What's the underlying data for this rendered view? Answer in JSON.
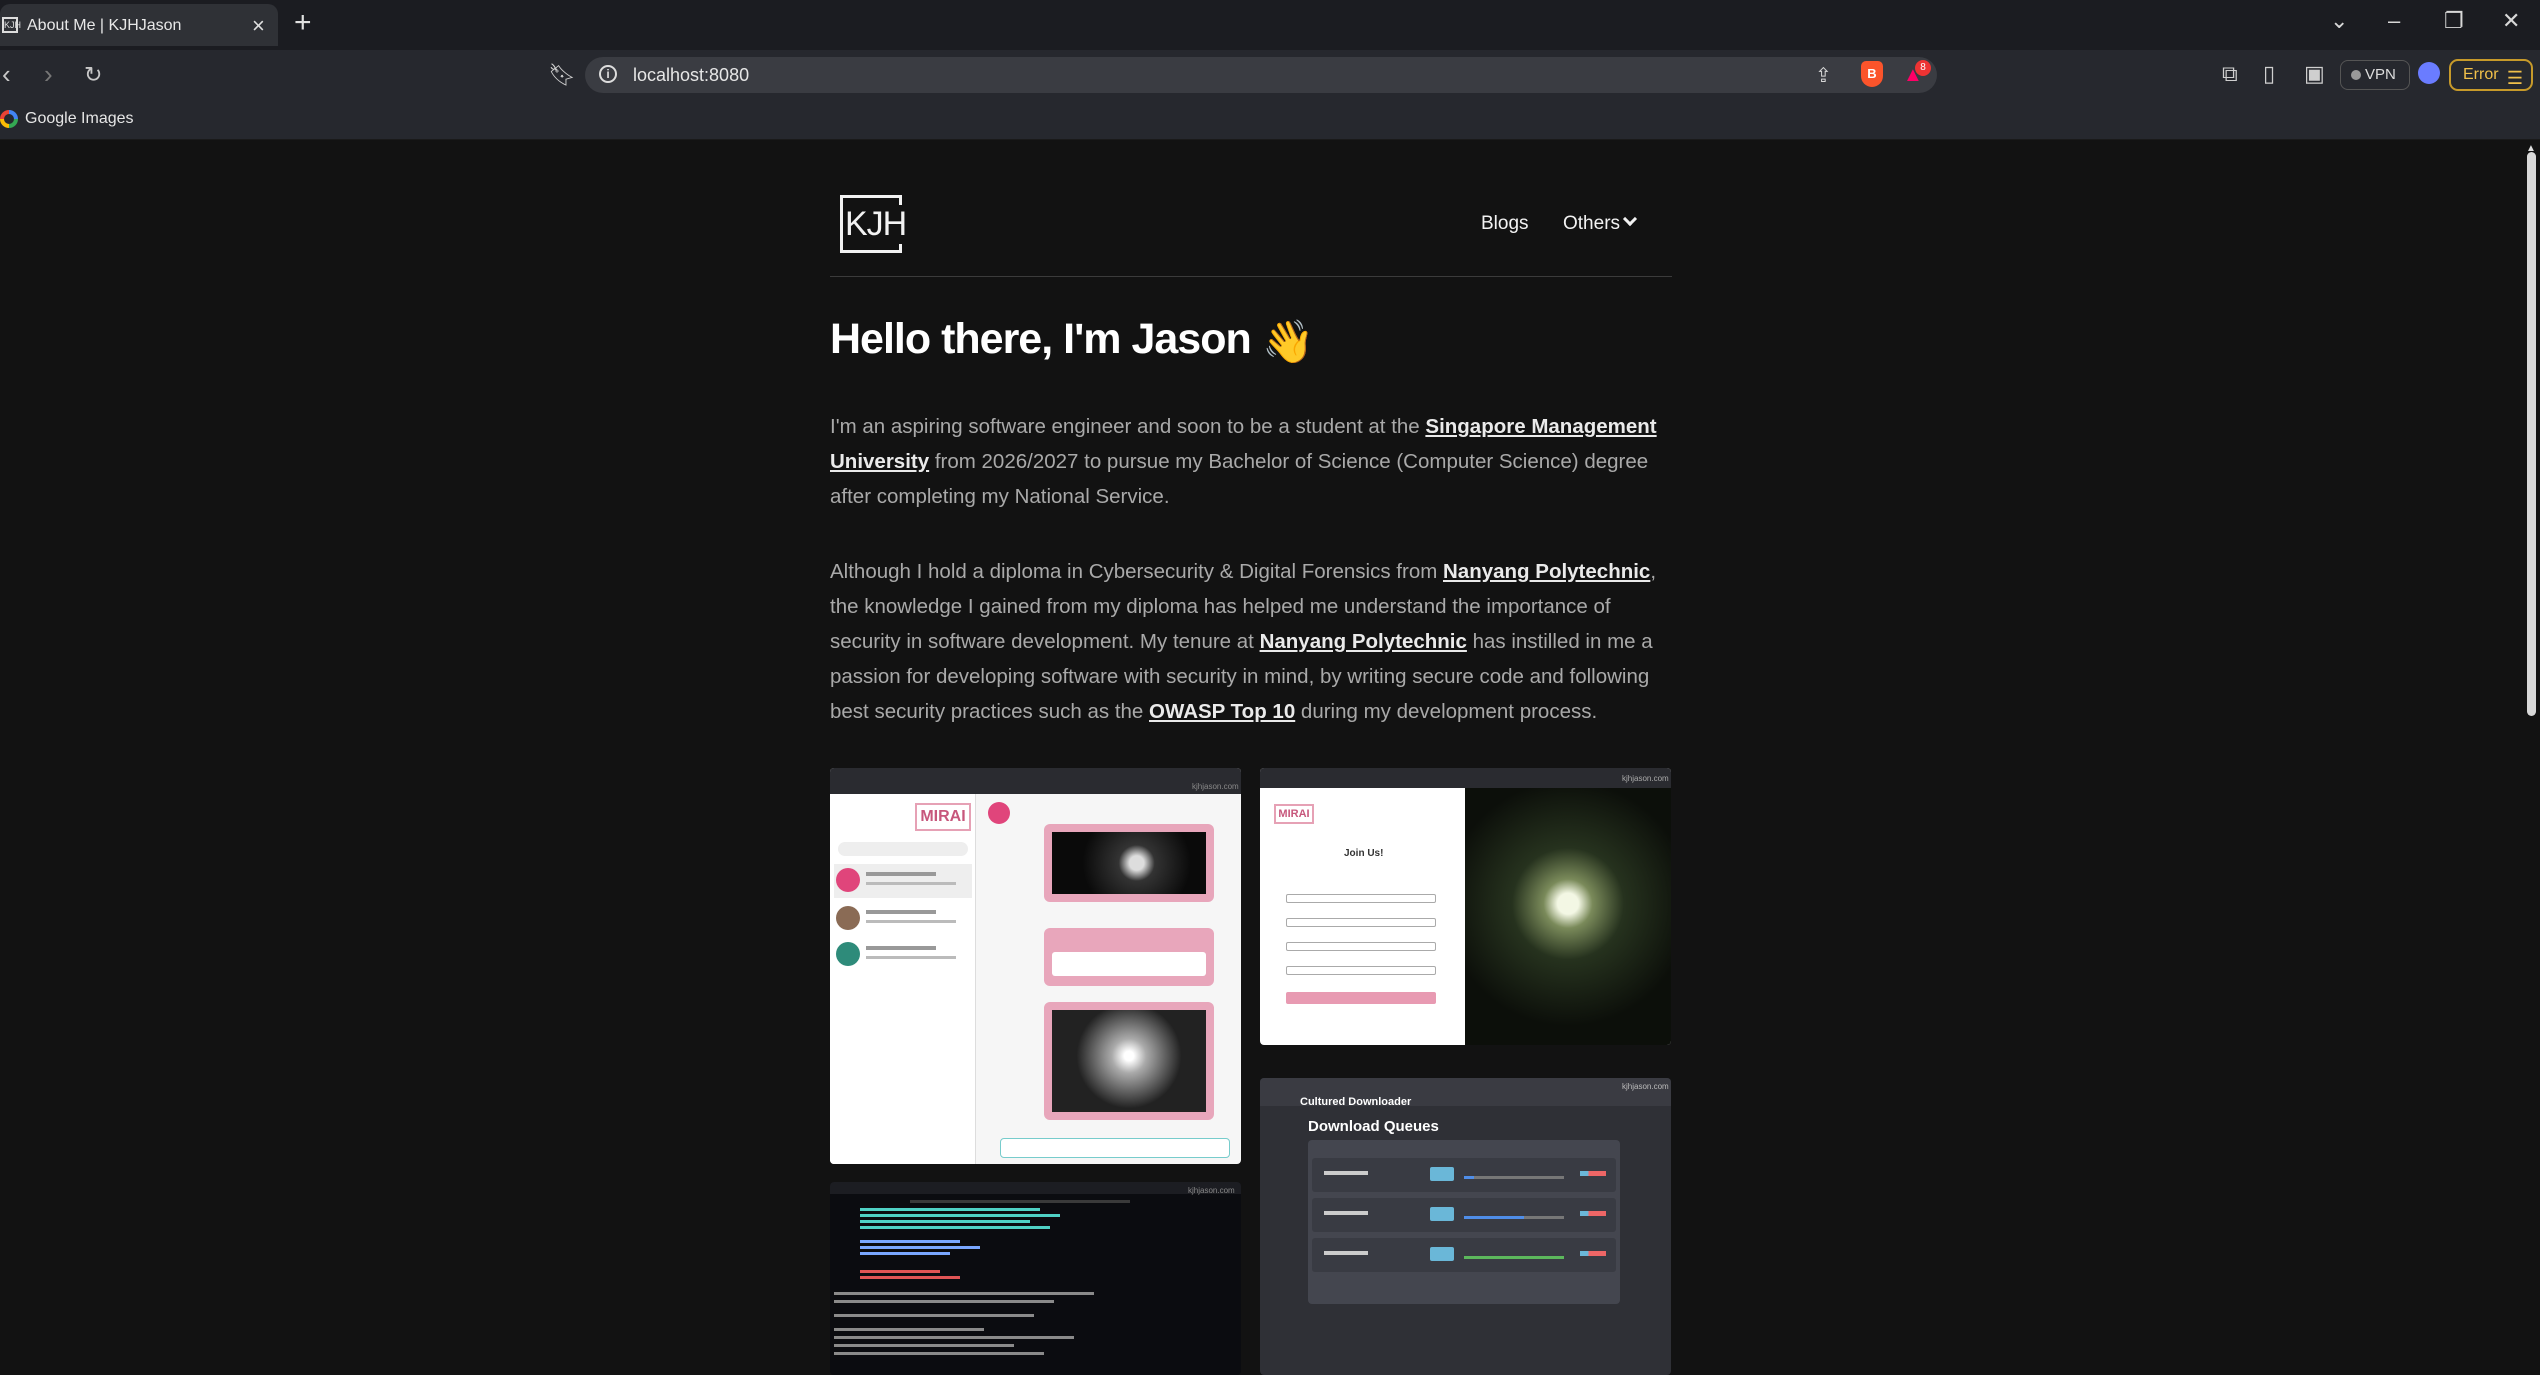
{
  "browser": {
    "tab_title": "About Me | KJHJason",
    "tab_favicon": "KJH",
    "url": "localhost:8080",
    "bookmark": "Google Images",
    "vpn_label": "VPN",
    "error_label": "Error",
    "rewards_badge": "8"
  },
  "site": {
    "logo": "KJH",
    "nav": [
      {
        "label": "Blogs"
      },
      {
        "label": "Others"
      }
    ]
  },
  "hero": {
    "title": "Hello there, I'm Jason",
    "emoji": "👋"
  },
  "intro": {
    "p1_a": "I'm an aspiring software engineer and soon to be a student at the ",
    "p1_link": "Singapore Management University",
    "p1_b": " from 2026/2027 to pursue my Bachelor of Science (Computer Science) degree after completing my National Service.",
    "p2_a": "Although I hold a diploma in Cybersecurity & Digital Forensics from ",
    "p2_link1": "Nanyang Polytechnic",
    "p2_b": ", the knowledge I gained from my diploma has helped me understand the importance of security in software development. My tenure at ",
    "p2_link2": "Nanyang Polytechnic",
    "p2_c": " has instilled in me a passion for developing software with security in mind, by writing secure code and following best security practices such as the ",
    "p2_link3": "OWASP Top 10",
    "p2_d": " during my development process."
  },
  "gallery": {
    "chat_brand": "MIRAI",
    "join_brand": "MIRAI",
    "join_title": "Join Us!",
    "downloader_title": "Cultured Downloader",
    "downloader_heading": "Download Queues",
    "watermark": "kjhjason.com"
  },
  "colors": {
    "page_bg": "#121212",
    "link": "#eaeaea",
    "body_text": "#a9a9a9",
    "error_accent": "#f1c04a"
  }
}
